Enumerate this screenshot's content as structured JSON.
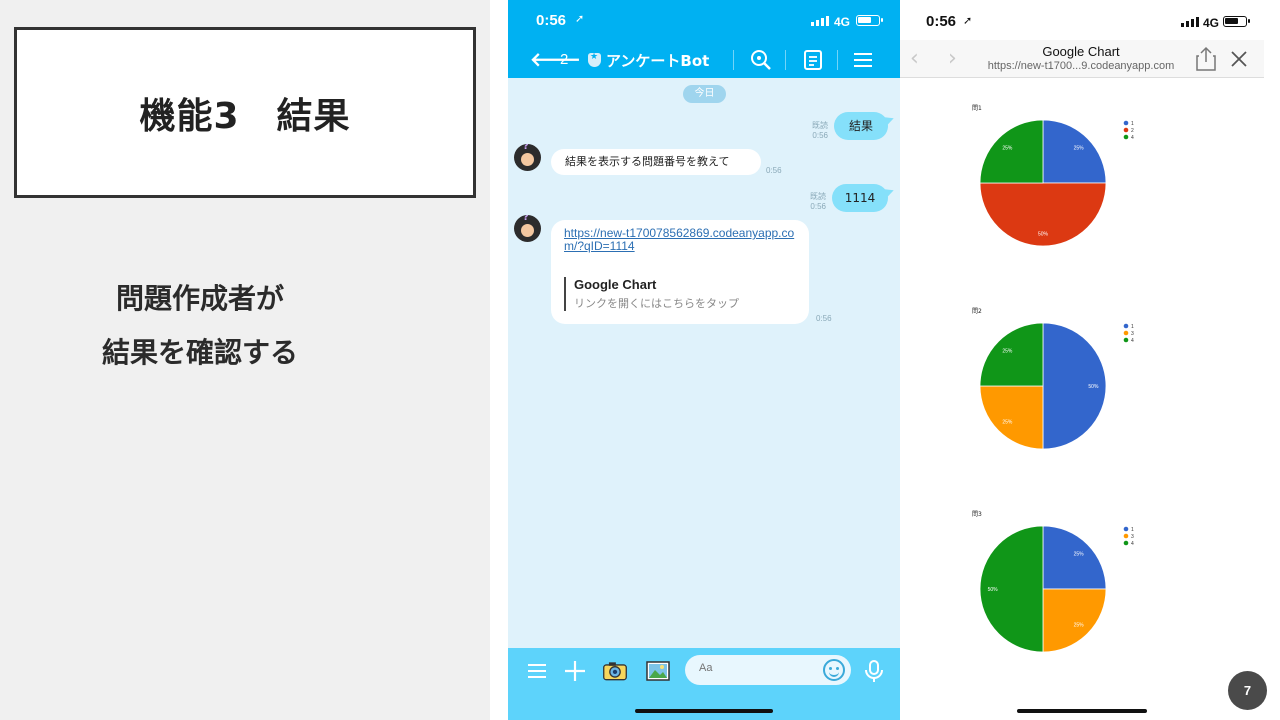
{
  "slide": {
    "title": "機能3　結果",
    "description_line1": "問題作成者が",
    "description_line2": "結果を確認する",
    "page_number": "7"
  },
  "line_chat": {
    "status": {
      "time": "0:56",
      "network": "4G"
    },
    "header": {
      "back_count": "2",
      "title": "アンケートBot"
    },
    "day_label": "今日",
    "messages": [
      {
        "from": "user",
        "text": "結果",
        "read": "既読",
        "time": "0:56"
      },
      {
        "from": "bot",
        "text": "結果を表示する問題番号を教えて",
        "time": "0:56"
      },
      {
        "from": "user",
        "text": "1114",
        "read": "既読",
        "time": "0:56"
      },
      {
        "from": "bot",
        "link_url": "https://new-t170078562869.codeanyapp.com/?qID=1114",
        "link_title": "Google Chart",
        "link_subtitle": "リンクを開くにはこちらをタップ",
        "time": "0:56"
      }
    ],
    "input_placeholder": "Aa"
  },
  "browser": {
    "status": {
      "time": "0:56",
      "network": "4G"
    },
    "page_title": "Google Chart",
    "url": "https://new-t1700...9.codeanyapp.com"
  },
  "colors": {
    "line_blue": "#00b1f2",
    "chat_bg": "#dff2fb",
    "outgoing_bubble": "#85e0fa",
    "pie_blue": "#3366cc",
    "pie_red": "#dc3912",
    "pie_orange": "#ff9900",
    "pie_green": "#109618"
  },
  "chart_data": [
    {
      "type": "pie",
      "title": "問1",
      "series": [
        {
          "name": "1",
          "value": 25,
          "label": "25%",
          "color": "#3366cc"
        },
        {
          "name": "2",
          "value": 50,
          "label": "50%",
          "color": "#dc3912"
        },
        {
          "name": "4",
          "value": 25,
          "label": "25%",
          "color": "#109618"
        }
      ],
      "legend": "right"
    },
    {
      "type": "pie",
      "title": "問2",
      "series": [
        {
          "name": "1",
          "value": 50,
          "label": "50%",
          "color": "#3366cc"
        },
        {
          "name": "3",
          "value": 25,
          "label": "25%",
          "color": "#ff9900"
        },
        {
          "name": "4",
          "value": 25,
          "label": "25%",
          "color": "#109618"
        }
      ],
      "legend": "right"
    },
    {
      "type": "pie",
      "title": "問3",
      "series": [
        {
          "name": "1",
          "value": 25,
          "label": "25%",
          "color": "#3366cc"
        },
        {
          "name": "3",
          "value": 25,
          "label": "25%",
          "color": "#ff9900"
        },
        {
          "name": "4",
          "value": 50,
          "label": "50%",
          "color": "#109618"
        }
      ],
      "legend": "right"
    }
  ]
}
